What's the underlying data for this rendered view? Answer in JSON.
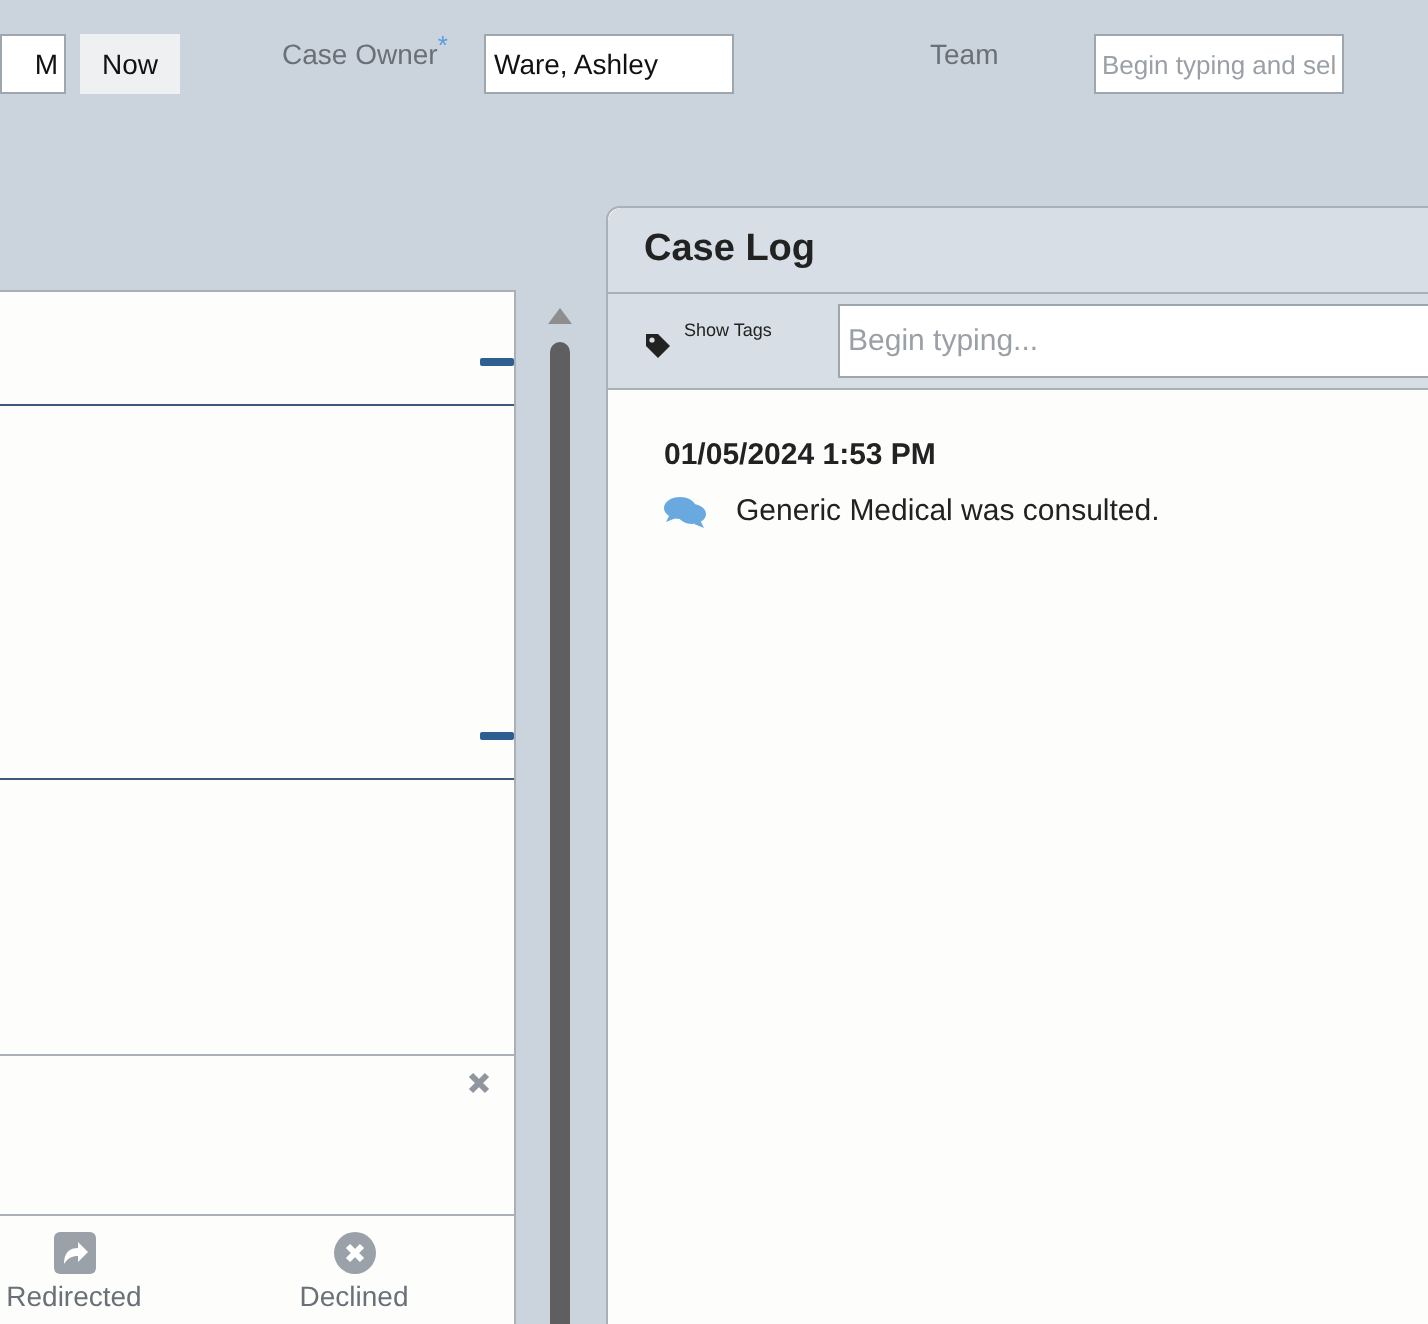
{
  "header": {
    "time_field": {
      "value": "M"
    },
    "now_button": "Now",
    "case_owner": {
      "label": "Case Owner",
      "required_mark": "*",
      "value": "Ware, Ashley"
    },
    "team": {
      "label": "Team",
      "placeholder": "Begin typing and sel"
    }
  },
  "left_panel": {
    "sections": [
      {
        "expanded": true
      },
      {
        "expanded": true
      }
    ],
    "dialog": {
      "actions": [
        {
          "label": "Redirected",
          "kind": "redirect"
        },
        {
          "label": "Declined",
          "kind": "decline"
        }
      ]
    }
  },
  "case_log": {
    "title": "Case Log",
    "show_tags": "Show Tags",
    "search_placeholder": "Begin typing...",
    "entries": [
      {
        "timestamp": "01/05/2024 1:53 PM",
        "text": "Generic Medical was consulted.",
        "kind": "consult"
      }
    ]
  }
}
